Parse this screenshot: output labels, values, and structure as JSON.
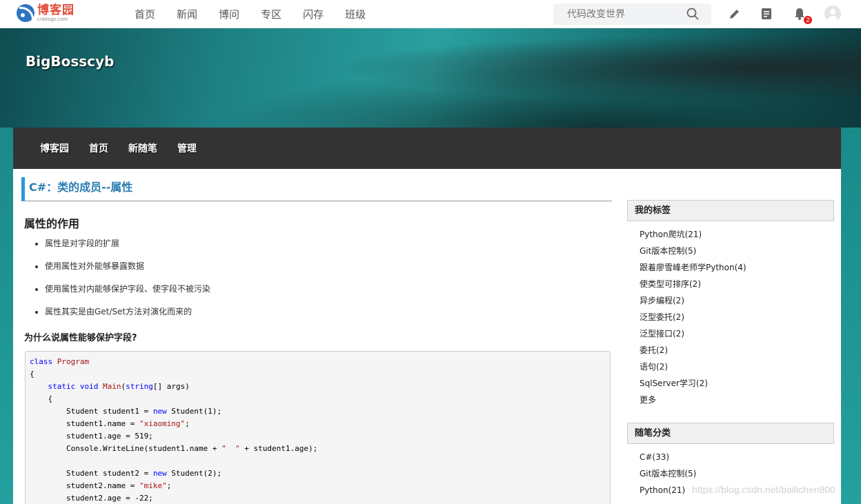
{
  "topnav": {
    "logo_cn": "博客园",
    "logo_en": "cnblogs.com",
    "links": [
      "首页",
      "新闻",
      "博问",
      "专区",
      "闪存",
      "班级"
    ],
    "search_placeholder": "代码改变世界",
    "notification_count": "2"
  },
  "banner": {
    "blog_title": "BigBosscyb"
  },
  "blognav": {
    "items": [
      "博客园",
      "首页",
      "新随笔",
      "管理"
    ]
  },
  "post": {
    "title": "C#：类的成员--属性",
    "heading": "属性的作用",
    "bullets": [
      "属性是对字段的扩展",
      "使用属性对外能够暴露数据",
      "使用属性对内能够保护字段、使字段不被污染",
      "属性其实是由Get/Set方法对演化而来的"
    ],
    "subheading": "为什么说属性能够保护字段?",
    "code_lines": [
      "class Program",
      "{",
      "    static void Main(string[] args)",
      "    {",
      "        Student student1 = new Student(1);",
      "        student1.name = \"xiaoming\";",
      "        student1.age = 519;",
      "        Console.WriteLine(student1.name + \"  \" + student1.age);",
      "",
      "        Student student2 = new Student(2);",
      "        student2.name = \"mike\";",
      "        student2.age = -22;"
    ]
  },
  "sidebar": {
    "tags_title": "我的标签",
    "tags": [
      "Python爬坑(21)",
      "Git版本控制(5)",
      "跟着廖雪峰老师学Python(4)",
      "使类型可排序(2)",
      "异步编程(2)",
      "泛型委托(2)",
      "泛型接口(2)",
      "委托(2)",
      "语句(2)",
      "SqlServer学习(2)",
      "更多"
    ],
    "categories_title": "随笔分类",
    "categories": [
      "C#(33)",
      "Git版本控制(5)",
      "Python(21)"
    ]
  },
  "watermark": "https://blog.csdn.net/bailichen800",
  "colors": {
    "accent": "#2a98d6",
    "title_link": "#2b7db2",
    "nav_bg": "#333333",
    "badge": "#e02020"
  }
}
